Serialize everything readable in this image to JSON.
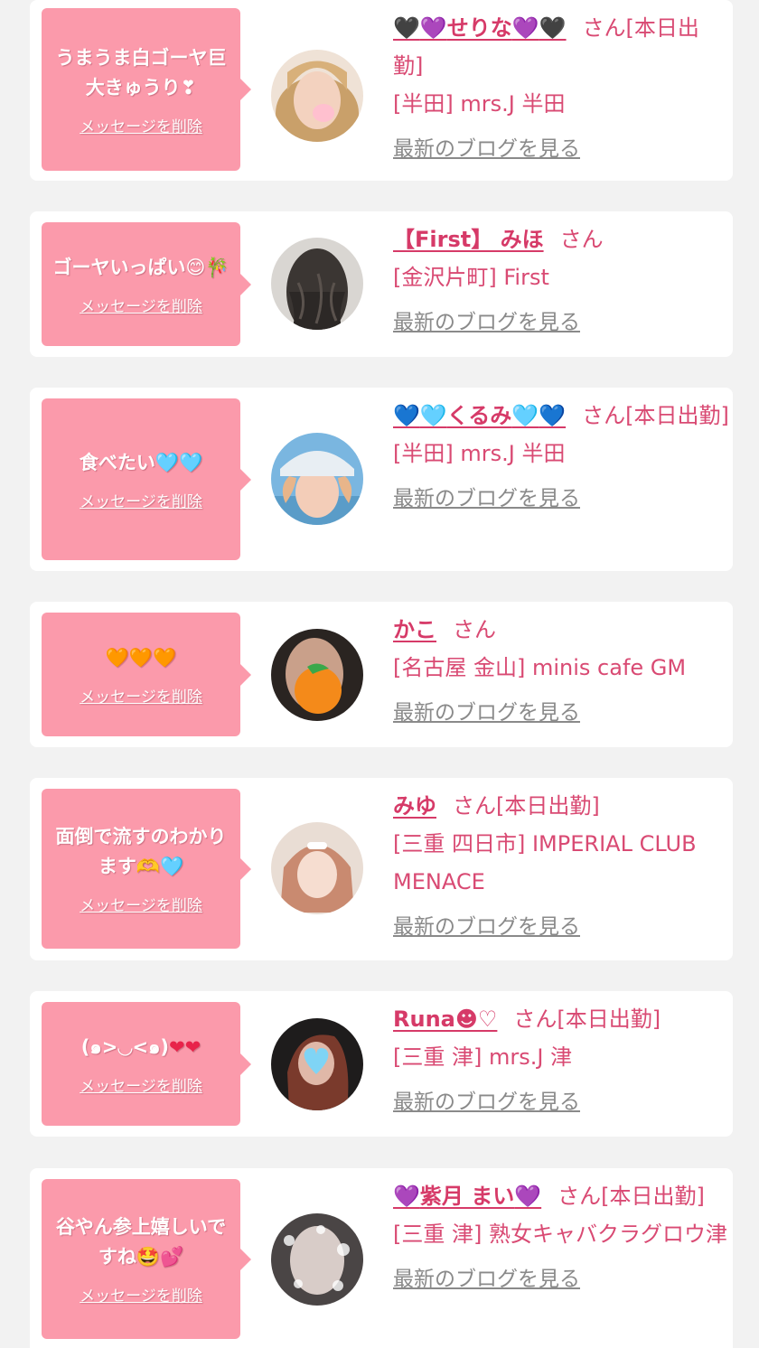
{
  "delete_label": "メッセージを削除",
  "blog_label": "最新のブログを見る",
  "colors": {
    "bubble": "#fb9aab",
    "accent": "#d63a68",
    "text": "#d94a73",
    "link_gray": "#8a8a8a",
    "background": "#f2f2f2"
  },
  "items": [
    {
      "message": "うまうま白ゴーヤ巨大きゅうり❣",
      "name": "🖤💜せりな💜🖤",
      "suffix": "さん[本日出勤]",
      "shop": "[半田] mrs.J 半田",
      "avatar": "photo-blonde-woman"
    },
    {
      "message": "ゴーヤいっぱい😊🎋",
      "name": "【First】 みほ",
      "suffix": "さん",
      "shop": "[金沢片町] First",
      "avatar": "photo-long-dark-hair"
    },
    {
      "message": "食べたい🩵🩵",
      "name": "💙🩵くるみ🩵💙",
      "suffix": "さん[本日出勤]",
      "shop": "[半田] mrs.J 半田",
      "avatar": "photo-woman-with-cap"
    },
    {
      "message": "🧡🧡🧡",
      "name": "かこ",
      "suffix": "さん",
      "shop": "[名古屋 金山] minis cafe GM",
      "avatar": "photo-orange-covered-face"
    },
    {
      "message": "面倒で流すのわかります🫶🩵",
      "name": "みゆ",
      "suffix": "さん[本日出勤]",
      "shop": "[三重 四日市] IMPERIAL CLUB MENACE",
      "avatar": "photo-pink-hair-woman"
    },
    {
      "message": "(๑>◡<๑)❤❤",
      "name": "Runa☻♡",
      "suffix": "さん[本日出勤]",
      "shop": "[三重 津] mrs.J 津",
      "avatar": "photo-heart-covered-face"
    },
    {
      "message": "谷やん参上嬉しいですね🤩💕",
      "name": "💜紫月 まい💜",
      "suffix": "さん[本日出勤]",
      "shop": "[三重 津] 熟女キャバクラグロウ津",
      "avatar": "photo-sparkle-blur-woman"
    }
  ]
}
